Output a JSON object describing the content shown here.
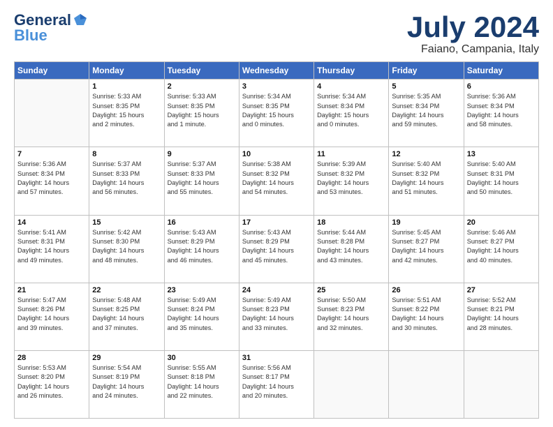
{
  "logo": {
    "general": "General",
    "blue": "Blue"
  },
  "title": {
    "month": "July 2024",
    "location": "Faiano, Campania, Italy"
  },
  "days_header": [
    "Sunday",
    "Monday",
    "Tuesday",
    "Wednesday",
    "Thursday",
    "Friday",
    "Saturday"
  ],
  "weeks": [
    [
      {
        "day": "",
        "info": ""
      },
      {
        "day": "1",
        "info": "Sunrise: 5:33 AM\nSunset: 8:35 PM\nDaylight: 15 hours\nand 2 minutes."
      },
      {
        "day": "2",
        "info": "Sunrise: 5:33 AM\nSunset: 8:35 PM\nDaylight: 15 hours\nand 1 minute."
      },
      {
        "day": "3",
        "info": "Sunrise: 5:34 AM\nSunset: 8:35 PM\nDaylight: 15 hours\nand 0 minutes."
      },
      {
        "day": "4",
        "info": "Sunrise: 5:34 AM\nSunset: 8:34 PM\nDaylight: 15 hours\nand 0 minutes."
      },
      {
        "day": "5",
        "info": "Sunrise: 5:35 AM\nSunset: 8:34 PM\nDaylight: 14 hours\nand 59 minutes."
      },
      {
        "day": "6",
        "info": "Sunrise: 5:36 AM\nSunset: 8:34 PM\nDaylight: 14 hours\nand 58 minutes."
      }
    ],
    [
      {
        "day": "7",
        "info": "Sunrise: 5:36 AM\nSunset: 8:34 PM\nDaylight: 14 hours\nand 57 minutes."
      },
      {
        "day": "8",
        "info": "Sunrise: 5:37 AM\nSunset: 8:33 PM\nDaylight: 14 hours\nand 56 minutes."
      },
      {
        "day": "9",
        "info": "Sunrise: 5:37 AM\nSunset: 8:33 PM\nDaylight: 14 hours\nand 55 minutes."
      },
      {
        "day": "10",
        "info": "Sunrise: 5:38 AM\nSunset: 8:32 PM\nDaylight: 14 hours\nand 54 minutes."
      },
      {
        "day": "11",
        "info": "Sunrise: 5:39 AM\nSunset: 8:32 PM\nDaylight: 14 hours\nand 53 minutes."
      },
      {
        "day": "12",
        "info": "Sunrise: 5:40 AM\nSunset: 8:32 PM\nDaylight: 14 hours\nand 51 minutes."
      },
      {
        "day": "13",
        "info": "Sunrise: 5:40 AM\nSunset: 8:31 PM\nDaylight: 14 hours\nand 50 minutes."
      }
    ],
    [
      {
        "day": "14",
        "info": "Sunrise: 5:41 AM\nSunset: 8:31 PM\nDaylight: 14 hours\nand 49 minutes."
      },
      {
        "day": "15",
        "info": "Sunrise: 5:42 AM\nSunset: 8:30 PM\nDaylight: 14 hours\nand 48 minutes."
      },
      {
        "day": "16",
        "info": "Sunrise: 5:43 AM\nSunset: 8:29 PM\nDaylight: 14 hours\nand 46 minutes."
      },
      {
        "day": "17",
        "info": "Sunrise: 5:43 AM\nSunset: 8:29 PM\nDaylight: 14 hours\nand 45 minutes."
      },
      {
        "day": "18",
        "info": "Sunrise: 5:44 AM\nSunset: 8:28 PM\nDaylight: 14 hours\nand 43 minutes."
      },
      {
        "day": "19",
        "info": "Sunrise: 5:45 AM\nSunset: 8:27 PM\nDaylight: 14 hours\nand 42 minutes."
      },
      {
        "day": "20",
        "info": "Sunrise: 5:46 AM\nSunset: 8:27 PM\nDaylight: 14 hours\nand 40 minutes."
      }
    ],
    [
      {
        "day": "21",
        "info": "Sunrise: 5:47 AM\nSunset: 8:26 PM\nDaylight: 14 hours\nand 39 minutes."
      },
      {
        "day": "22",
        "info": "Sunrise: 5:48 AM\nSunset: 8:25 PM\nDaylight: 14 hours\nand 37 minutes."
      },
      {
        "day": "23",
        "info": "Sunrise: 5:49 AM\nSunset: 8:24 PM\nDaylight: 14 hours\nand 35 minutes."
      },
      {
        "day": "24",
        "info": "Sunrise: 5:49 AM\nSunset: 8:23 PM\nDaylight: 14 hours\nand 33 minutes."
      },
      {
        "day": "25",
        "info": "Sunrise: 5:50 AM\nSunset: 8:23 PM\nDaylight: 14 hours\nand 32 minutes."
      },
      {
        "day": "26",
        "info": "Sunrise: 5:51 AM\nSunset: 8:22 PM\nDaylight: 14 hours\nand 30 minutes."
      },
      {
        "day": "27",
        "info": "Sunrise: 5:52 AM\nSunset: 8:21 PM\nDaylight: 14 hours\nand 28 minutes."
      }
    ],
    [
      {
        "day": "28",
        "info": "Sunrise: 5:53 AM\nSunset: 8:20 PM\nDaylight: 14 hours\nand 26 minutes."
      },
      {
        "day": "29",
        "info": "Sunrise: 5:54 AM\nSunset: 8:19 PM\nDaylight: 14 hours\nand 24 minutes."
      },
      {
        "day": "30",
        "info": "Sunrise: 5:55 AM\nSunset: 8:18 PM\nDaylight: 14 hours\nand 22 minutes."
      },
      {
        "day": "31",
        "info": "Sunrise: 5:56 AM\nSunset: 8:17 PM\nDaylight: 14 hours\nand 20 minutes."
      },
      {
        "day": "",
        "info": ""
      },
      {
        "day": "",
        "info": ""
      },
      {
        "day": "",
        "info": ""
      }
    ]
  ]
}
